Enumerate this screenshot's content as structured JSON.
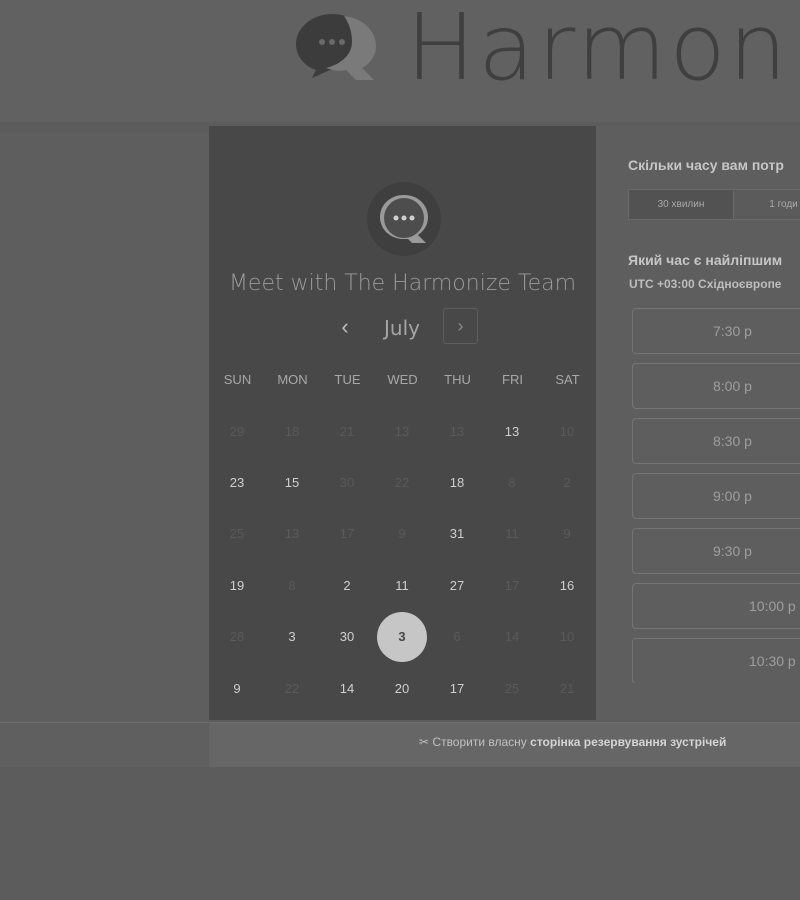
{
  "header": {
    "brand": "Harmoni"
  },
  "scheduler": {
    "title": "Meet with The Harmonize Team",
    "month": "July",
    "prev_label": "‹",
    "next_label": "›",
    "weekdays": [
      "SUN",
      "MON",
      "TUE",
      "WED",
      "THU",
      "FRI",
      "SAT"
    ],
    "weeks": [
      [
        {
          "d": "29",
          "a": false
        },
        {
          "d": "18",
          "a": false
        },
        {
          "d": "21",
          "a": false
        },
        {
          "d": "13",
          "a": false
        },
        {
          "d": "13",
          "a": false
        },
        {
          "d": "13",
          "a": true
        },
        {
          "d": "10",
          "a": false
        }
      ],
      [
        {
          "d": "23",
          "a": true
        },
        {
          "d": "15",
          "a": true
        },
        {
          "d": "30",
          "a": false
        },
        {
          "d": "22",
          "a": false
        },
        {
          "d": "18",
          "a": true
        },
        {
          "d": "8",
          "a": false
        },
        {
          "d": "2",
          "a": false
        }
      ],
      [
        {
          "d": "25",
          "a": false
        },
        {
          "d": "13",
          "a": false
        },
        {
          "d": "17",
          "a": false
        },
        {
          "d": "9",
          "a": false
        },
        {
          "d": "31",
          "a": true
        },
        {
          "d": "11",
          "a": false
        },
        {
          "d": "9",
          "a": false
        }
      ],
      [
        {
          "d": "19",
          "a": true
        },
        {
          "d": "8",
          "a": false
        },
        {
          "d": "2",
          "a": true
        },
        {
          "d": "11",
          "a": true
        },
        {
          "d": "27",
          "a": true
        },
        {
          "d": "17",
          "a": false
        },
        {
          "d": "16",
          "a": true
        }
      ],
      [
        {
          "d": "28",
          "a": false
        },
        {
          "d": "3",
          "a": true
        },
        {
          "d": "30",
          "a": true
        },
        {
          "d": "3",
          "a": true,
          "selected": true
        },
        {
          "d": "6",
          "a": false
        },
        {
          "d": "14",
          "a": false
        },
        {
          "d": "10",
          "a": false
        }
      ],
      [
        {
          "d": "9",
          "a": true
        },
        {
          "d": "22",
          "a": false
        },
        {
          "d": "14",
          "a": true
        },
        {
          "d": "20",
          "a": true
        },
        {
          "d": "17",
          "a": true
        },
        {
          "d": "25",
          "a": false
        },
        {
          "d": "21",
          "a": false
        }
      ]
    ]
  },
  "booking": {
    "duration_question": "Скільки часу вам потр",
    "durations": [
      "30 хвилин",
      "1 годи"
    ],
    "time_question": "Який час є найліпшим",
    "timezone": "UTC +03:00 Східноєвропе",
    "slots": [
      "7:30 p",
      "8:00 p",
      "8:30 p",
      "9:00 p",
      "9:30 p",
      "10:00 p",
      "10:30 p"
    ]
  },
  "footer": {
    "prefix": "Створити власну ",
    "link": "сторінка резервування зустрічей"
  }
}
